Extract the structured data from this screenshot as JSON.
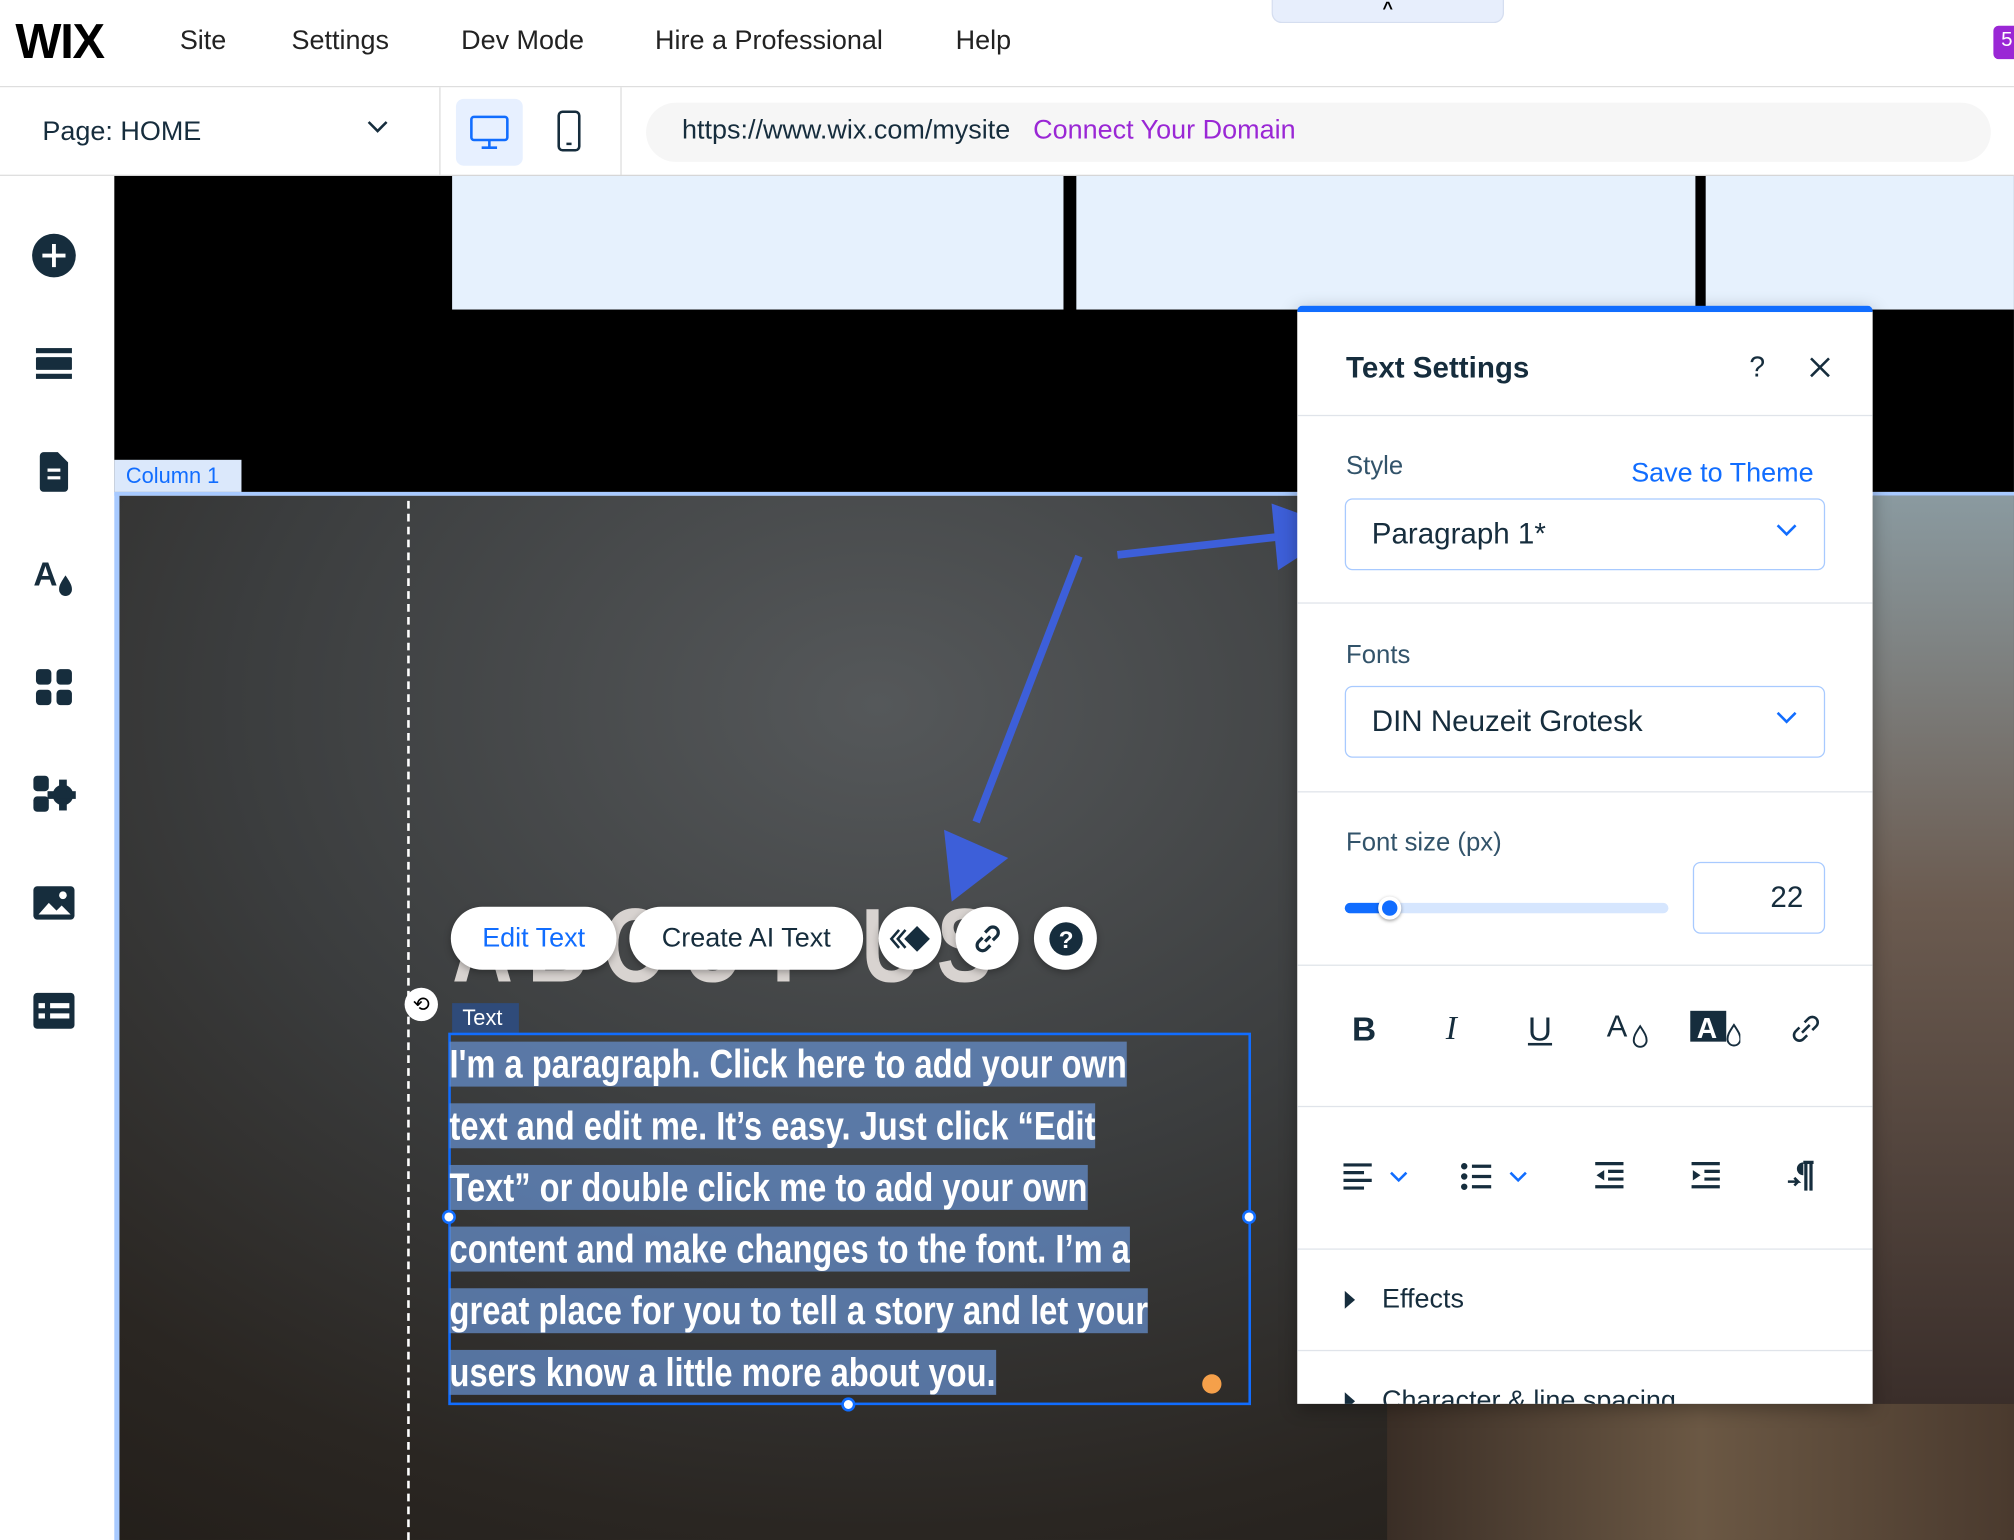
{
  "topbar": {
    "logo": "WIX",
    "menu": [
      "Site",
      "Settings",
      "Dev Mode",
      "Hire a Professional",
      "Help"
    ],
    "badge": "5"
  },
  "pagebar": {
    "page_label": "Page: HOME",
    "url": "https://www.wix.com/mysite",
    "connect_domain": "Connect Your Domain"
  },
  "sidebar": {
    "icons": [
      "add-icon",
      "sections-icon",
      "pages-icon",
      "theme-icon",
      "apps-icon",
      "business-apps-icon",
      "media-icon",
      "cms-icon"
    ]
  },
  "canvas": {
    "column_label": "Column 1",
    "heading": "ABOUT US",
    "element_label": "Text",
    "paragraph_lines": [
      "I'm a paragraph. Click here to add your own",
      "text and edit me. It’s easy. Just click “Edit",
      "Text” or double click me to add your own",
      "content and make changes to the font. I’m a",
      "great place for you to tell a story and let your",
      "users know a little more about you."
    ],
    "toolbar": {
      "edit_text": "Edit Text",
      "create_ai_text": "Create AI Text"
    }
  },
  "text_settings": {
    "title": "Text Settings",
    "help": "?",
    "style_label": "Style",
    "save_to_theme": "Save to Theme",
    "style_value": "Paragraph 1*",
    "fonts_label": "Fonts",
    "font_value": "DIN Neuzeit Grotesk",
    "font_size_label": "Font size (px)",
    "font_size_value": "22",
    "font_size_slider_fraction": 0.14,
    "effects": "Effects",
    "char_spacing": "Character & line spacing"
  },
  "colors": {
    "accent": "#116dff",
    "brand_purple": "#9a27d5",
    "annotation_arrow": "#3d5fd9"
  }
}
